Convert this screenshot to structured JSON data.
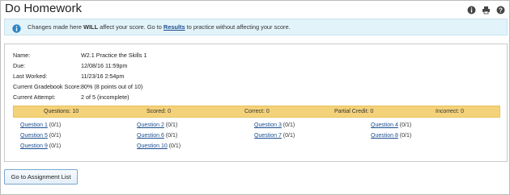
{
  "header": {
    "title": "Do Homework",
    "icons": [
      "info-icon",
      "print-icon",
      "help-icon"
    ]
  },
  "notice": {
    "prefix": "Changes made here ",
    "will": "WILL",
    "middle": " affect your score. Go to ",
    "link": "Results",
    "suffix": " to practice without affecting your score."
  },
  "assignment": {
    "rows": [
      {
        "label": "Name:",
        "value": "W2.1 Practice the Skills 1"
      },
      {
        "label": "Due:",
        "value": "12/08/16 11:59pm"
      },
      {
        "label": "Last Worked:",
        "value": "11/23/16 2:54pm"
      },
      {
        "label": "Current Gradebook Score:",
        "value": "80% (8 points out of 10)"
      },
      {
        "label": "Current Attempt:",
        "value": "2 of 5 (incomplete)"
      }
    ]
  },
  "summary": {
    "questions": "Questions: 10",
    "scored": "Scored: 0",
    "correct": "Correct: 0",
    "partial": "Partial Credit: 0",
    "incorrect": "Incorrect: 0"
  },
  "questions": [
    {
      "link": "Question 1",
      "pts": " (0/1)"
    },
    {
      "link": "Question 2",
      "pts": " (0/1)"
    },
    {
      "link": "Question 3",
      "pts": " (0/1)"
    },
    {
      "link": "Question 4",
      "pts": " (0/1)"
    },
    {
      "link": "Question 5",
      "pts": " (0/1)"
    },
    {
      "link": "Question 6",
      "pts": " (0/1)"
    },
    {
      "link": "Question 7",
      "pts": " (0/1)"
    },
    {
      "link": "Question 8",
      "pts": " (0/1)"
    },
    {
      "link": "Question 9",
      "pts": " (0/1)"
    },
    {
      "link": "Question 10",
      "pts": " (0/1)"
    }
  ],
  "footer": {
    "button_label": "Go to Assignment List"
  },
  "colors": {
    "notice_bg": "#e2f3fa",
    "summary_bg": "#f4d27a",
    "link": "#1b4f90",
    "info_icon": "#2f86c4"
  }
}
